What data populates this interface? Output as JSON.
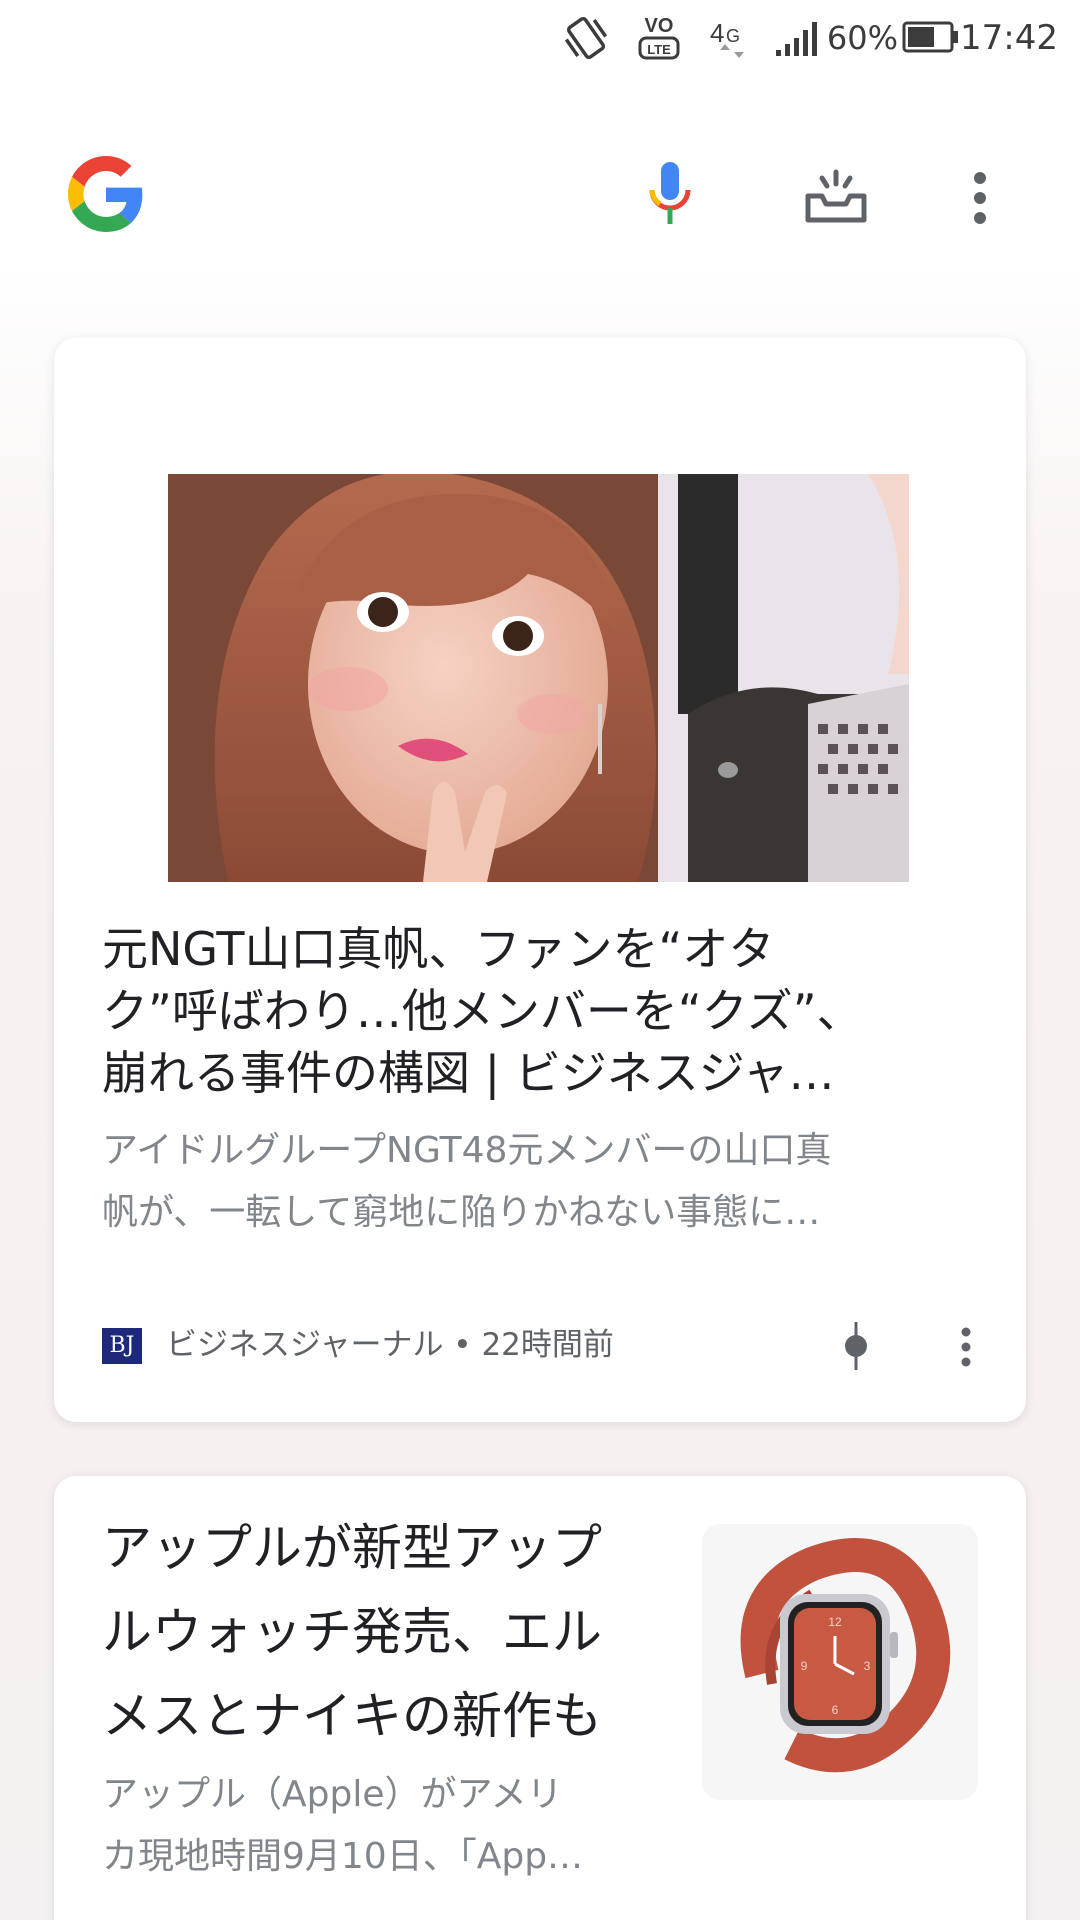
{
  "status_bar": {
    "battery_percent": "60%",
    "time": "17:42",
    "network": "4G",
    "volte": "VO LTE"
  },
  "header": {
    "logo_letter": "G",
    "icons": [
      "google-logo",
      "mic-icon",
      "updates-tray-icon",
      "more-vert-icon"
    ]
  },
  "articles": [
    {
      "title_lines": [
        "元NGT山口真帆、ファンを“オタ",
        "ク”呼ばわり…他メンバーを“クズ”、",
        "崩れる事件の構図 | ビジネスジャ…"
      ],
      "snippet_lines": [
        "アイドルグループNGT48元メンバーの山口真",
        "帆が、一転して窮地に陥りかねない事態に…"
      ],
      "source": "ビジネスジャーナル • 22時間前",
      "source_logo_text": "BJ"
    },
    {
      "title_lines": [
        "アップルが新型アップ",
        "ルウォッチ発売、エル",
        "メスとナイキの新作も"
      ],
      "snippet_lines": [
        "アップル（Apple）がアメリ",
        "カ現地時間9月10日、「App…"
      ]
    }
  ],
  "colors": {
    "google_blue": "#4285F4",
    "google_red": "#EA4335",
    "google_yellow": "#FBBC05",
    "google_green": "#34A853",
    "title_text": "#202124",
    "secondary_text": "#80868b"
  }
}
